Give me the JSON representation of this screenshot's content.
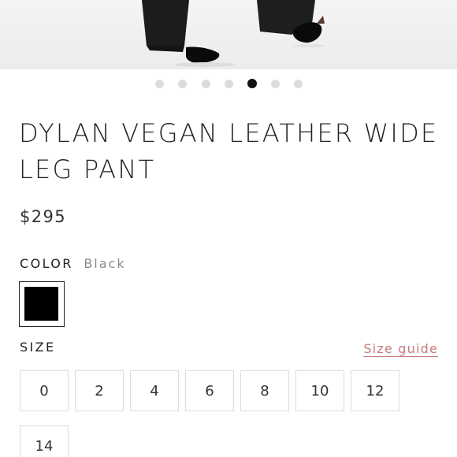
{
  "carousel": {
    "dot_count": 7,
    "active_index": 4
  },
  "product": {
    "title": "DYLAN VEGAN LEATHER WIDE LEG PANT",
    "price": "$295"
  },
  "color": {
    "label": "COLOR",
    "selected": "Black",
    "swatch_hex": "#000000"
  },
  "size": {
    "label": "SIZE",
    "guide_label": "Size guide",
    "options": [
      "0",
      "2",
      "4",
      "6",
      "8",
      "10",
      "12",
      "14"
    ]
  },
  "colors": {
    "accent_link": "#c87a7a",
    "active_dot": "#111111",
    "inactive_dot": "#dcdcdc"
  }
}
